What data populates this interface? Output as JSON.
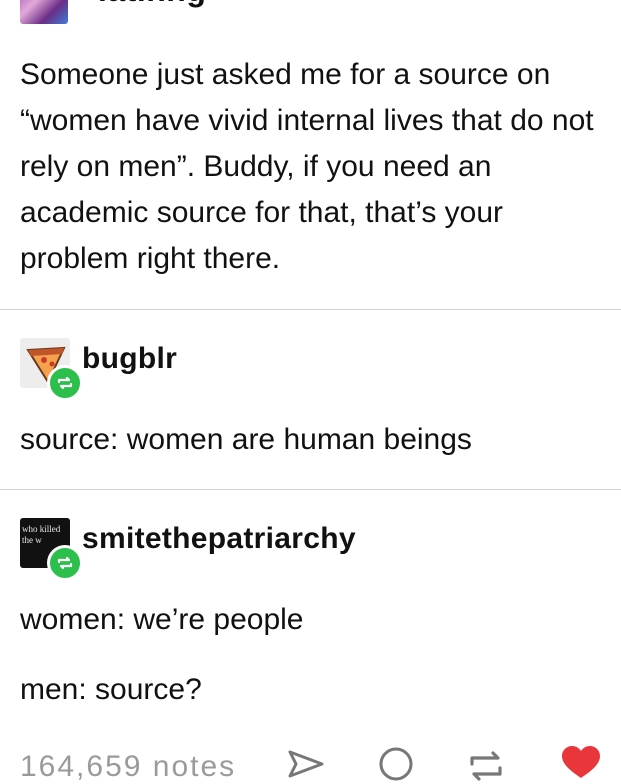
{
  "original_post": {
    "username": "latinng",
    "text": "Someone just asked me for a source on “women have vivid internal lives that do not rely on men”. Buddy, if you need an academic source for that, that’s your problem right there."
  },
  "reblogs": [
    {
      "username": "bugblr",
      "avatar_icon": "pizza-slice-icon",
      "text": "source: women are human beings"
    },
    {
      "username": "smitethepatriarchy",
      "avatar_icon": "text-avatar",
      "avatar_text": "who killed the w",
      "lines": [
        "women: we’re people",
        "men: source?"
      ]
    }
  ],
  "footer": {
    "notes": "164,659 notes",
    "icons": [
      "share-icon",
      "reply-icon",
      "reblog-icon",
      "like-heart-icon"
    ]
  },
  "colors": {
    "reblog_badge": "#2dbf4c",
    "heart": "#e8363a",
    "divider": "#d4d4d4"
  }
}
